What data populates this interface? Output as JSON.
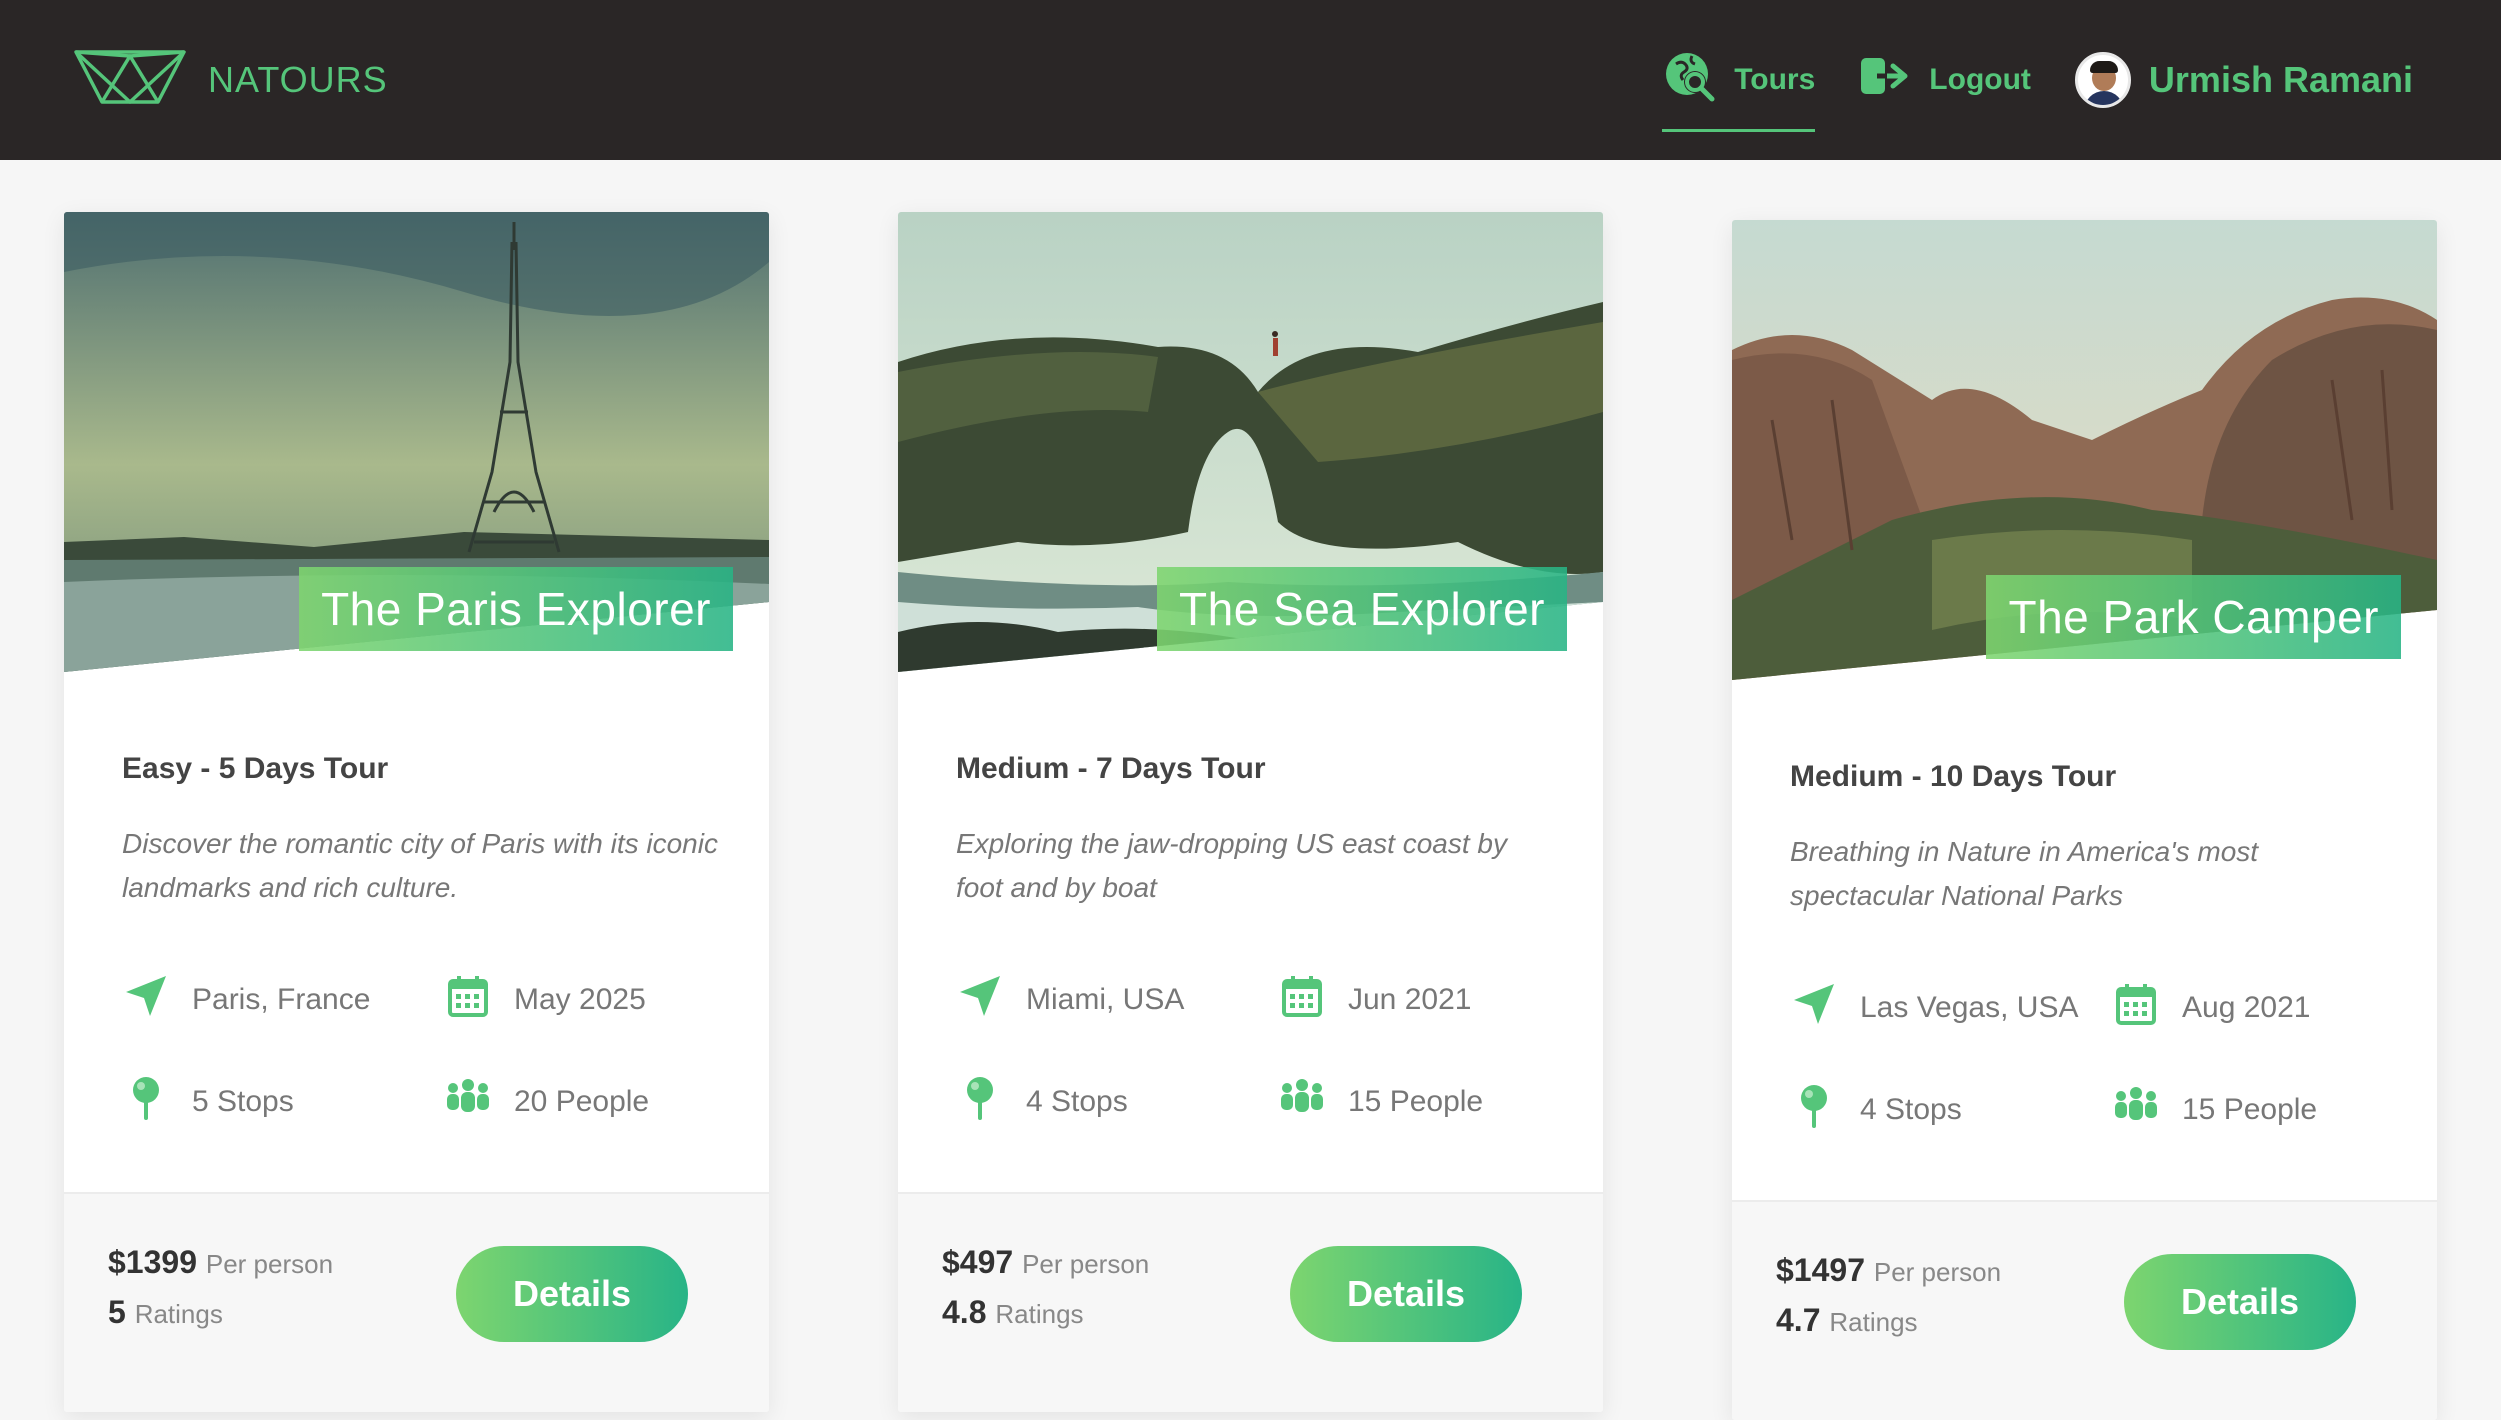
{
  "header": {
    "logo_text": "NATOURS",
    "nav": {
      "tours_label": "Tours",
      "logout_label": "Logout",
      "user_name": "Urmish Ramani"
    }
  },
  "colors": {
    "accent": "#55c57a",
    "header_bg": "#2a2626",
    "gradient_start": "#7dd56f",
    "gradient_end": "#28b487"
  },
  "tours": [
    {
      "name": "The Paris Explorer",
      "difficulty": "Easy - 5 Days Tour",
      "summary": "Discover the romantic city of Paris with its iconic landmarks and rich culture.",
      "location": "Paris, France",
      "date": "May 2025",
      "stops": "5 Stops",
      "people": "20 People",
      "price": "$1399",
      "price_unit": "Per person",
      "rating": "5",
      "rating_label": "Ratings",
      "button_label": "Details"
    },
    {
      "name": "The Sea Explorer",
      "difficulty": "Medium - 7 Days Tour",
      "summary": "Exploring the jaw-dropping US east coast by foot and by boat",
      "location": "Miami, USA",
      "date": "Jun 2021",
      "stops": "4 Stops",
      "people": "15 People",
      "price": "$497",
      "price_unit": "Per person",
      "rating": "4.8",
      "rating_label": "Ratings",
      "button_label": "Details"
    },
    {
      "name": "The Park Camper",
      "difficulty": "Medium - 10 Days Tour",
      "summary": "Breathing in Nature in America's most spectacular National Parks",
      "location": "Las Vegas, USA",
      "date": "Aug 2021",
      "stops": "4 Stops",
      "people": "15 People",
      "price": "$1497",
      "price_unit": "Per person",
      "rating": "4.7",
      "rating_label": "Ratings",
      "button_label": "Details"
    }
  ]
}
